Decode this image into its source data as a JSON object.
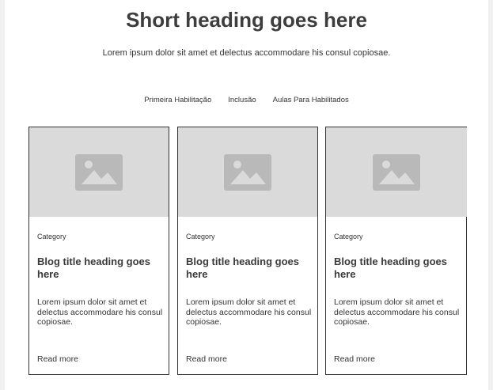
{
  "header": {
    "title": "Short heading goes here",
    "subtitle": "Lorem ipsum dolor sit amet et delectus accommodare his consul copiosae."
  },
  "filters": [
    {
      "label": "Primeira Habilitação"
    },
    {
      "label": "Inclusão"
    },
    {
      "label": "Aulas Para Habilitados"
    }
  ],
  "cards": [
    {
      "category": "Category",
      "title": "Blog title heading goes here",
      "text": "Lorem ipsum dolor sit amet et delectus accommodare his consul copiosae.",
      "link": "Read more",
      "image_icon": "image-placeholder-icon"
    },
    {
      "category": "Category",
      "title": "Blog title heading goes here",
      "text": "Lorem ipsum dolor sit amet et delectus accommodare his consul copiosae.",
      "link": "Read more",
      "image_icon": "image-placeholder-icon"
    },
    {
      "category": "Category",
      "title": "Blog title heading goes here",
      "text": "Lorem ipsum dolor sit amet et delectus accommodare his consul copiosae.",
      "link": "Read more",
      "image_icon": "image-placeholder-icon"
    }
  ],
  "colors": {
    "page_background": "#f1f1f1",
    "content_background": "#ffffff",
    "image_placeholder": "#dadada",
    "image_icon": "#b9b9b9",
    "text": "#333333",
    "border": "#333333"
  }
}
